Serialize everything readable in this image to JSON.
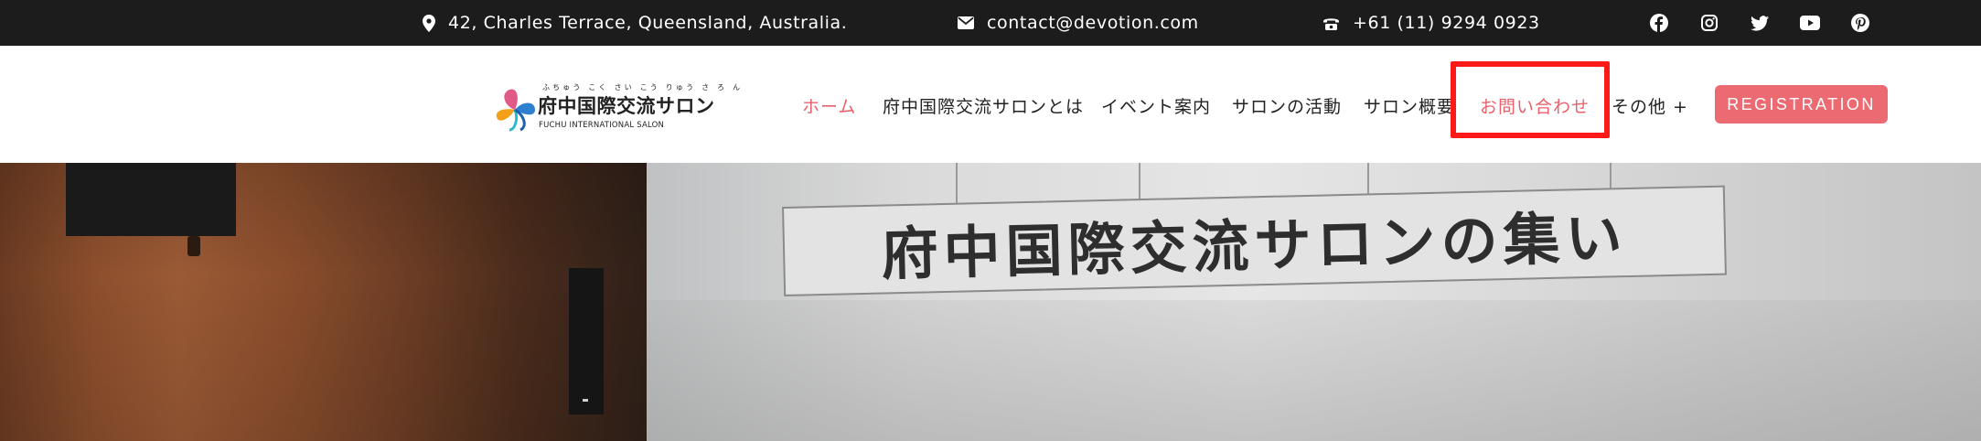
{
  "topbar": {
    "address": "42, Charles Terrace, Queensland, Australia.",
    "email": "contact@devotion.com",
    "phone": "+61 (11) 9294 0923",
    "social_icons": [
      "facebook-icon",
      "instagram-icon",
      "twitter-icon",
      "youtube-icon",
      "pinterest-icon"
    ],
    "background": "#1c1c1c"
  },
  "logo": {
    "ruby": "ふちゅう こく さい こう りゅう さ ろ ん",
    "name": "府中国際交流サロン",
    "subtitle": "FUCHU INTERNATIONAL SALON"
  },
  "nav": {
    "items": [
      {
        "label": "ホーム",
        "active": true
      },
      {
        "label": "府中国際交流サロンとは"
      },
      {
        "label": "イベント案内"
      },
      {
        "label": "サロンの活動"
      },
      {
        "label": "サロン概要"
      },
      {
        "label": "お問い合わせ",
        "highlighted": true
      },
      {
        "label": "その他 +"
      }
    ],
    "register_label": "REGISTRATION",
    "accent_color": "#e8626c",
    "highlight_color": "#ff1a1a"
  },
  "hero": {
    "banner_text": "府中国際交流サロンの集い"
  }
}
